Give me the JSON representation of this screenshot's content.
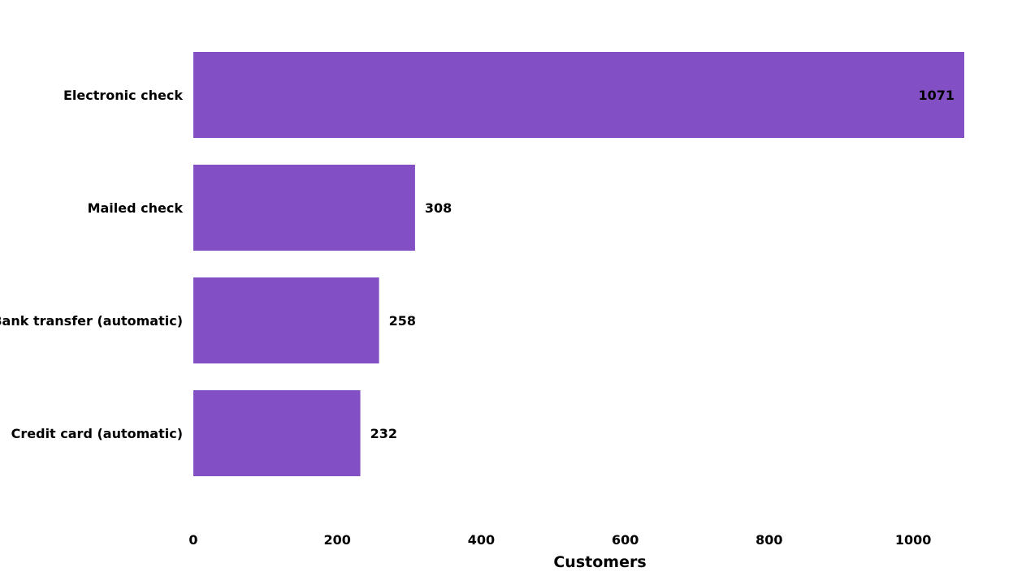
{
  "chart_data": {
    "type": "bar",
    "orientation": "horizontal",
    "categories": [
      "Electronic check",
      "Mailed check",
      "Bank transfer (automatic)",
      "Credit card (automatic)"
    ],
    "values": [
      1071,
      308,
      258,
      232
    ],
    "data_labels": [
      "1071",
      "308",
      "258",
      "232"
    ],
    "xlabel": "Customers",
    "ylabel": "",
    "title": "",
    "xlim": [
      0,
      1071
    ],
    "x_ticks": [
      0,
      200,
      400,
      600,
      800,
      1000
    ],
    "grid": false,
    "legend": "none",
    "bar_color": "#8250C4"
  }
}
